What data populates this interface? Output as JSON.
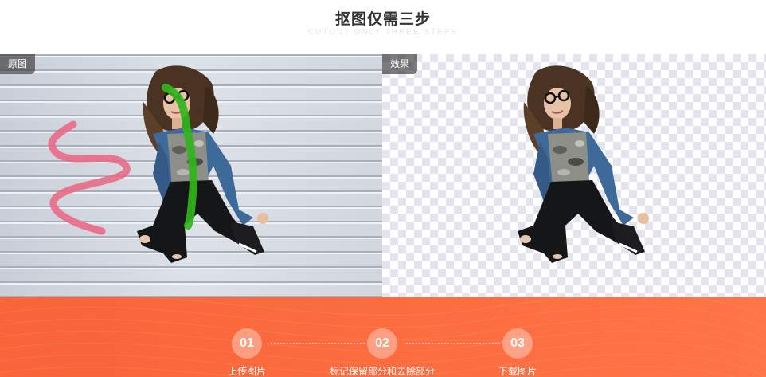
{
  "header": {
    "title": "抠图仅需三步",
    "subtitle": "CUTOUT ONLY THREE STEPS"
  },
  "panels": {
    "original_label": "原图",
    "result_label": "效果"
  },
  "steps": [
    {
      "number": "01",
      "label": "上传图片"
    },
    {
      "number": "02",
      "label": "标记保留部分和去除部分"
    },
    {
      "number": "03",
      "label": "下载图片"
    }
  ],
  "colors": {
    "accent": "#fc6d3f",
    "keep_stroke": "#2fb51a",
    "remove_stroke": "#e96a86"
  }
}
